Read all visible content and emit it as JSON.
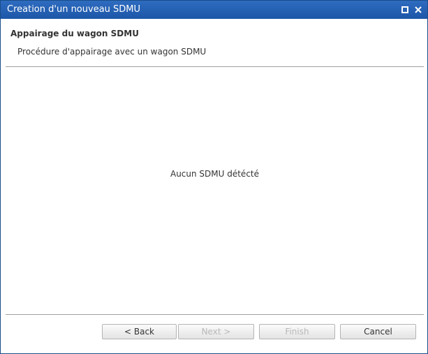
{
  "window": {
    "title": "Creation d'un nouveau SDMU",
    "maximize_icon": "maximize-icon",
    "close_icon": "close-icon"
  },
  "header": {
    "heading": "Appairage du wagon SDMU",
    "subheading": "Procédure d'appairage avec un wagon SDMU"
  },
  "content": {
    "message": "Aucun SDMU détécté"
  },
  "buttons": {
    "back": {
      "label": "< Back",
      "enabled": true
    },
    "next": {
      "label": "Next >",
      "enabled": false
    },
    "finish": {
      "label": "Finish",
      "enabled": false
    },
    "cancel": {
      "label": "Cancel",
      "enabled": true
    }
  },
  "colors": {
    "titlebar": "#1d56a8",
    "title_text": "#ffffff",
    "disabled_text": "#b8b8b8"
  }
}
